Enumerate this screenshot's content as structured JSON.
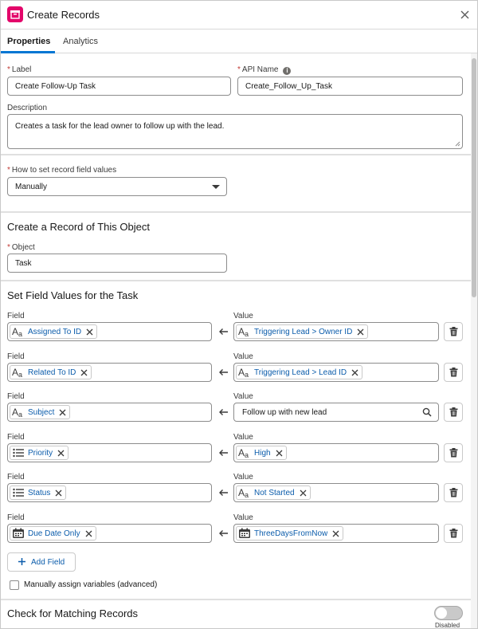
{
  "header": {
    "title": "Create Records"
  },
  "tabs": [
    {
      "label": "Properties"
    },
    {
      "label": "Analytics"
    }
  ],
  "form": {
    "label": {
      "label": "Label",
      "value": "Create Follow-Up Task"
    },
    "api_name": {
      "label": "API Name",
      "value": "Create_Follow_Up_Task",
      "info_glyph": "i"
    },
    "description": {
      "label": "Description",
      "value": "Creates a task for the lead owner to follow up with the lead."
    },
    "set_values": {
      "label": "How to set record field values",
      "value": "Manually"
    }
  },
  "object_section": {
    "title": "Create a Record of This Object",
    "object": {
      "label": "Object",
      "value": "Task"
    }
  },
  "fields_section": {
    "title": "Set Field Values for the Task",
    "field_header": "Field",
    "value_header": "Value",
    "rows": [
      {
        "field": "Assigned To ID",
        "field_icon": "text-type-icon",
        "value": "Triggering Lead > Owner ID",
        "value_icon": "text-type-icon",
        "value_kind": "pill"
      },
      {
        "field": "Related To ID",
        "field_icon": "text-type-icon",
        "value": "Triggering Lead > Lead ID",
        "value_icon": "text-type-icon",
        "value_kind": "pill"
      },
      {
        "field": "Subject",
        "field_icon": "text-type-icon",
        "value": "Follow up with new lead",
        "value_icon": "search-icon",
        "value_kind": "text"
      },
      {
        "field": "Priority",
        "field_icon": "picklist-icon",
        "value": "High",
        "value_icon": "text-type-icon",
        "value_kind": "pill"
      },
      {
        "field": "Status",
        "field_icon": "picklist-icon",
        "value": "Not Started",
        "value_icon": "text-type-icon",
        "value_kind": "pill"
      },
      {
        "field": "Due Date Only",
        "field_icon": "calendar-icon",
        "value": "ThreeDaysFromNow",
        "value_icon": "calendar-icon",
        "value_kind": "pill"
      }
    ],
    "add_field_label": "Add Field",
    "manual_assign_label": "Manually assign variables (advanced)",
    "manual_assign_checked": false
  },
  "matching_section": {
    "title": "Check for Matching Records",
    "toggle_label": "Disabled",
    "toggle_on": false
  },
  "colors": {
    "accent": "#0176d3",
    "link": "#0b5cab",
    "app_icon": "#e3066a",
    "required": "#c23934"
  }
}
